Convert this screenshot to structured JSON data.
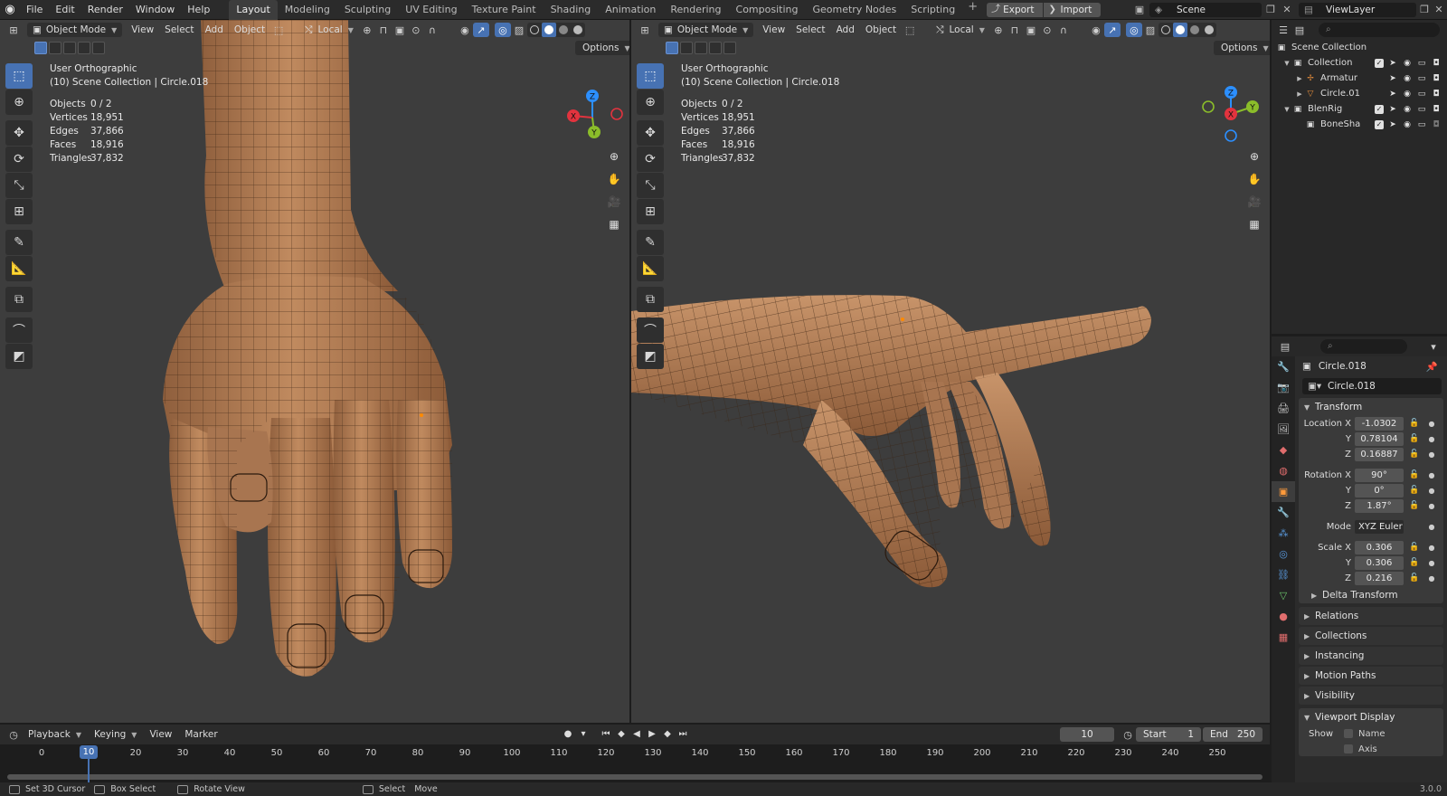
{
  "menu": {
    "items": [
      "File",
      "Edit",
      "Render",
      "Window",
      "Help"
    ],
    "workspaces": [
      "Layout",
      "Modeling",
      "Sculpting",
      "UV Editing",
      "Texture Paint",
      "Shading",
      "Animation",
      "Rendering",
      "Compositing",
      "Geometry Nodes",
      "Scripting"
    ],
    "active_workspace": "Layout",
    "plus": "+",
    "export_label": "Export",
    "import_label": "Import",
    "scene": "Scene",
    "view_layer": "ViewLayer"
  },
  "viewport_header": {
    "mode": "Object Mode",
    "menus": [
      "View",
      "Select",
      "Add",
      "Object"
    ],
    "orientation": "Local",
    "options": "Options"
  },
  "viewports": [
    {
      "projection": "User Orthographic",
      "collection_line": "(10) Scene Collection | Circle.018",
      "stats": [
        {
          "key": "Objects",
          "value": "0 / 2"
        },
        {
          "key": "Vertices",
          "value": "18,951"
        },
        {
          "key": "Edges",
          "value": "37,866"
        },
        {
          "key": "Faces",
          "value": "18,916"
        },
        {
          "key": "Triangles",
          "value": "37,832"
        }
      ]
    },
    {
      "projection": "User Orthographic",
      "collection_line": "(10) Scene Collection | Circle.018",
      "stats": [
        {
          "key": "Objects",
          "value": "0 / 2"
        },
        {
          "key": "Vertices",
          "value": "18,951"
        },
        {
          "key": "Edges",
          "value": "37,866"
        },
        {
          "key": "Faces",
          "value": "18,916"
        },
        {
          "key": "Triangles",
          "value": "37,832"
        }
      ]
    }
  ],
  "gizmo": {
    "x": "X",
    "y": "Y",
    "z": "Z"
  },
  "outliner": {
    "rows": [
      {
        "name": "Scene Collection",
        "icon": "scene-collection-icon"
      },
      {
        "name": "Collection",
        "icon": "collection-icon"
      },
      {
        "name": "Armatur",
        "icon": "armature-icon"
      },
      {
        "name": "Circle.01",
        "icon": "mesh-icon"
      },
      {
        "name": "BlenRig",
        "icon": "collection-icon"
      },
      {
        "name": "BoneSha",
        "icon": "collection-icon"
      }
    ]
  },
  "properties": {
    "object_name": "Circle.018",
    "data_name": "Circle.018",
    "transform_title": "Transform",
    "location": {
      "label": "Location X",
      "x": "-1.0302",
      "y": "0.78104",
      "z": "0.16887"
    },
    "rotation": {
      "label": "Rotation X",
      "x": "90°",
      "y": "0°",
      "z": "1.87°"
    },
    "mode": {
      "label": "Mode",
      "value": "XYZ Euler"
    },
    "scale": {
      "label": "Scale X",
      "x": "0.306",
      "y": "0.306",
      "z": "0.216"
    },
    "axis_y": "Y",
    "axis_z": "Z",
    "delta_transform": "Delta Transform",
    "panels": [
      "Relations",
      "Collections",
      "Instancing",
      "Motion Paths",
      "Visibility"
    ],
    "viewport_display": "Viewport Display",
    "show_label": "Show",
    "show_name": "Name",
    "show_axis": "Axis"
  },
  "timeline": {
    "menus": [
      "Playback",
      "Keying",
      "View",
      "Marker"
    ],
    "current_frame": "10",
    "start_label": "Start",
    "start": "1",
    "end_label": "End",
    "end": "250",
    "ticks": [
      "0",
      "10",
      "20",
      "30",
      "40",
      "50",
      "60",
      "70",
      "80",
      "90",
      "100",
      "110",
      "120",
      "130",
      "140",
      "150",
      "160",
      "170",
      "180",
      "190",
      "200",
      "210",
      "220",
      "230",
      "240",
      "250"
    ]
  },
  "statusbar": {
    "items": [
      "Set 3D Cursor",
      "Box Select",
      "Rotate View",
      "Select",
      "Move"
    ],
    "version": "3.0.0"
  },
  "colors": {
    "accent": "#4772b3",
    "axis_x": "#e2333e",
    "axis_y": "#8bbd2a",
    "axis_z": "#2c8fff",
    "skin": "#b07a52",
    "wire": "#3a2414"
  }
}
